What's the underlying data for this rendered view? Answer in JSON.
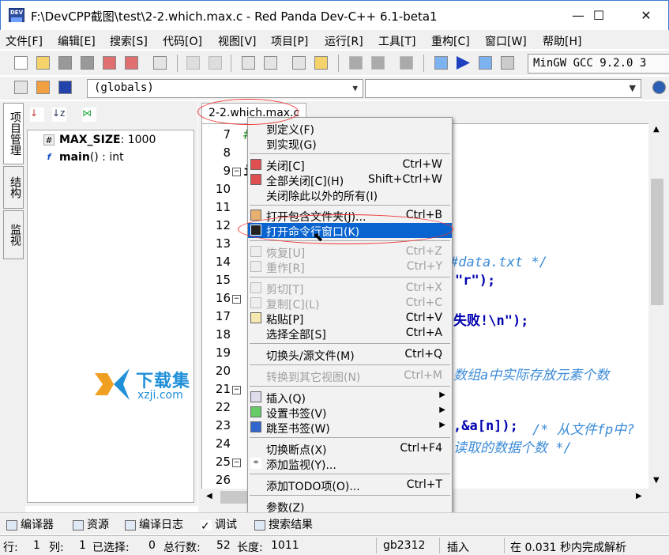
{
  "window": {
    "icon_text": "DEV",
    "title": "F:\\DevCPP截图\\test\\2-2.which.max.c - Red Panda Dev-C++ 6.1-beta1",
    "minimize": "—",
    "maximize": "☐",
    "close": "✕"
  },
  "menu": [
    "文件[F]",
    "编辑[E]",
    "搜索[S]",
    "代码[O]",
    "视图[V]",
    "项目[P]",
    "运行[R]",
    "工具[T]",
    "重构[C]",
    "窗口[W]",
    "帮助[H]"
  ],
  "toolbar": {
    "compiler": "MinGW GCC 9.2.0 3"
  },
  "toolbar2": {
    "scope": "(globals)"
  },
  "side_tabs": [
    "项目管理",
    "结构",
    "监视"
  ],
  "class_browser": [
    {
      "icon": "#",
      "name": "MAX_SIZE",
      "detail": ": 1000"
    },
    {
      "icon": "f",
      "name": "main",
      "detail": "() : int"
    }
  ],
  "editor": {
    "tab": "2-2.which.max.c",
    "lines": [
      "7",
      "8",
      "9",
      "10",
      "11",
      "12",
      "13",
      "14",
      "15",
      "16",
      "17",
      "18",
      "19",
      "20",
      "21",
      "22",
      "23",
      "24",
      "25",
      "26"
    ],
    "fold_lines": [
      "9",
      "16",
      "21",
      "25"
    ],
    "code": {
      "l7": "#",
      "l9": "i",
      "l14": "#data.txt */",
      "l15": "\"r\");",
      "l17": "失败!\\n\");",
      "l20": "数组a中实际存放元素个数",
      "l23a": ",&a[n]); ",
      "l23b": "/* 从文件fp中?",
      "l24": "读取的数据个数 */"
    }
  },
  "context_menu": [
    {
      "label": "到定义(F)",
      "shortcut": "",
      "enabled": true
    },
    {
      "label": "到实现(G)",
      "shortcut": "",
      "enabled": true
    },
    {
      "label": "关闭[C]",
      "shortcut": "Ctrl+W",
      "enabled": true
    },
    {
      "label": "全部关闭[C](H)",
      "shortcut": "Shift+Ctrl+W",
      "enabled": true
    },
    {
      "label": "关闭除此以外的所有(I)",
      "shortcut": "",
      "enabled": true
    },
    {
      "label": "打开包含文件夹(J)...",
      "shortcut": "Ctrl+B",
      "enabled": true
    },
    {
      "label": "打开命令行窗口(K)",
      "shortcut": "",
      "enabled": true,
      "selected": true
    },
    {
      "label": "恢复[U]",
      "shortcut": "Ctrl+Z",
      "enabled": false
    },
    {
      "label": "重作[R]",
      "shortcut": "Ctrl+Y",
      "enabled": false
    },
    {
      "label": "剪切[T]",
      "shortcut": "Ctrl+X",
      "enabled": false
    },
    {
      "label": "复制[C](L)",
      "shortcut": "Ctrl+C",
      "enabled": false
    },
    {
      "label": "粘贴[P]",
      "shortcut": "Ctrl+V",
      "enabled": true
    },
    {
      "label": "选择全部[S]",
      "shortcut": "Ctrl+A",
      "enabled": true
    },
    {
      "label": "切换头/源文件(M)",
      "shortcut": "Ctrl+Q",
      "enabled": true
    },
    {
      "label": "转换到其它视图(N)",
      "shortcut": "Ctrl+M",
      "enabled": false
    },
    {
      "label": "插入(Q)",
      "shortcut": "",
      "enabled": true,
      "submenu": true
    },
    {
      "label": "设置书签(V)",
      "shortcut": "",
      "enabled": true,
      "submenu": true
    },
    {
      "label": "跳至书签(W)",
      "shortcut": "",
      "enabled": true,
      "submenu": true
    },
    {
      "label": "切换断点(X)",
      "shortcut": "Ctrl+F4",
      "enabled": true
    },
    {
      "label": "添加监视(Y)...",
      "shortcut": "",
      "enabled": true
    },
    {
      "label": "添加TODO项(O)...",
      "shortcut": "Ctrl+T",
      "enabled": true
    },
    {
      "label": "参数(Z)",
      "shortcut": "",
      "enabled": true
    }
  ],
  "watermark": {
    "title": "下载集",
    "url": "xzji.com"
  },
  "bottom_tabs": [
    "编译器",
    "资源",
    "编译日志",
    "调试",
    "搜索结果"
  ],
  "status": {
    "row_label": "行:",
    "row": "1",
    "col_label": "列:",
    "col": "1",
    "sel_label": "已选择:",
    "sel": "0",
    "total_label": "总行数:",
    "total": "52",
    "len_label": "长度:",
    "len": "1011",
    "encoding": "gb2312",
    "mode": "插入",
    "parse": "在 0.031 秒内完成解析"
  },
  "colors": {
    "selection": "#0a64d0",
    "annotation": "#ee3333",
    "comment": "#3b8bd6",
    "string": "#0000b0"
  }
}
